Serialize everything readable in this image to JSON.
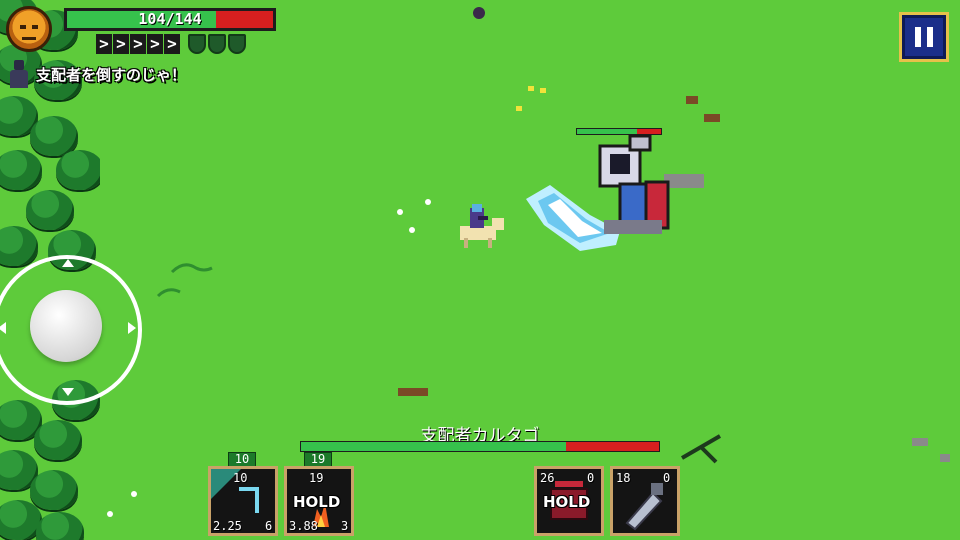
{
  "hud": {
    "hp_text": "104/144",
    "hp_fraction": 0.722,
    "quest_text": "支配者を倒すのじゃ！",
    "pause_label": "pause"
  },
  "boss": {
    "name": "支配者カルタゴ",
    "hp_fraction": 0.74,
    "overhead_hp_fraction": 0.72
  },
  "skills": [
    {
      "badge": "10",
      "top": "10",
      "bottom_left": "2.25",
      "bottom_right": "6",
      "hold": ""
    },
    {
      "badge": "19",
      "top": "19",
      "bottom_left": "3.88",
      "bottom_right": "3",
      "hold": "HOLD"
    },
    {
      "badge": "",
      "top": "26",
      "top_right": "0",
      "bottom_left": "",
      "bottom_right": "",
      "hold": "HOLD"
    },
    {
      "badge": "",
      "top": "18",
      "top_right": "0",
      "bottom_left": "",
      "bottom_right": "",
      "hold": ""
    }
  ],
  "colors": {
    "grass": "#5ecb3b",
    "hp_green": "#36c24c",
    "hp_red": "#d61f1f",
    "pause_bg": "#1b2e8a",
    "slot_border": "#c9a268"
  },
  "icons": [
    "player-portrait-icon",
    "quest-giver-icon",
    "pause-icon",
    "joystick",
    "slash-icon",
    "armor-icon",
    "shield-icon"
  ]
}
